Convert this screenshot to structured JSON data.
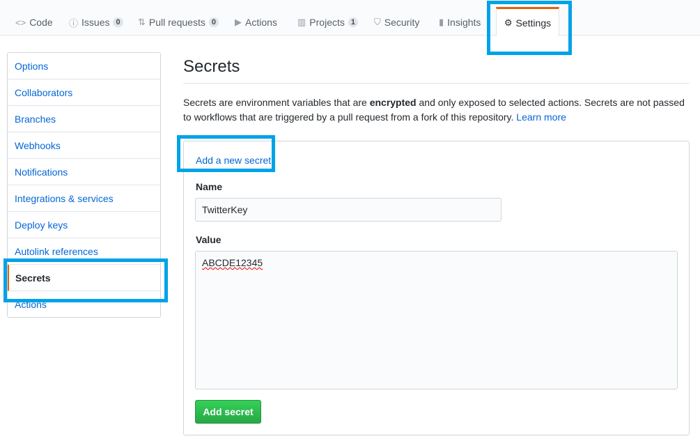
{
  "tabs": [
    {
      "label": "Code",
      "icon": "code-icon",
      "glyph": "<>"
    },
    {
      "label": "Issues",
      "icon": "issue-icon",
      "glyph": "ⓘ",
      "count": "0"
    },
    {
      "label": "Pull requests",
      "icon": "pull-request-icon",
      "glyph": "⇅",
      "count": "0"
    },
    {
      "label": "Actions",
      "icon": "play-icon",
      "glyph": "▶"
    },
    {
      "label": "Projects",
      "icon": "project-icon",
      "glyph": "▥",
      "count": "1"
    },
    {
      "label": "Security",
      "icon": "shield-icon",
      "glyph": "⛉"
    },
    {
      "label": "Insights",
      "icon": "graph-icon",
      "glyph": "▮"
    },
    {
      "label": "Settings",
      "icon": "gear-icon",
      "glyph": "⚙",
      "selected": true
    }
  ],
  "sidebar": {
    "items": [
      {
        "label": "Options"
      },
      {
        "label": "Collaborators"
      },
      {
        "label": "Branches"
      },
      {
        "label": "Webhooks"
      },
      {
        "label": "Notifications"
      },
      {
        "label": "Integrations & services"
      },
      {
        "label": "Deploy keys"
      },
      {
        "label": "Autolink references"
      },
      {
        "label": "Secrets",
        "selected": true
      },
      {
        "label": "Actions"
      }
    ]
  },
  "main": {
    "title": "Secrets",
    "desc_before": "Secrets are environment variables that are ",
    "desc_bold": "encrypted",
    "desc_after": " and only exposed to selected actions. Secrets are not passed to workflows that are triggered by a pull request from a fork of this repository. ",
    "learn_more": "Learn more",
    "form": {
      "heading_link": "Add a new secret",
      "name_label": "Name",
      "name_value": "TwitterKey",
      "value_label": "Value",
      "value_value": "ABCDE12345",
      "submit": "Add secret"
    }
  },
  "colors": {
    "highlight": "#00a2e8",
    "accent": "#e36209",
    "link": "#0366d6",
    "button": "#28a745"
  }
}
